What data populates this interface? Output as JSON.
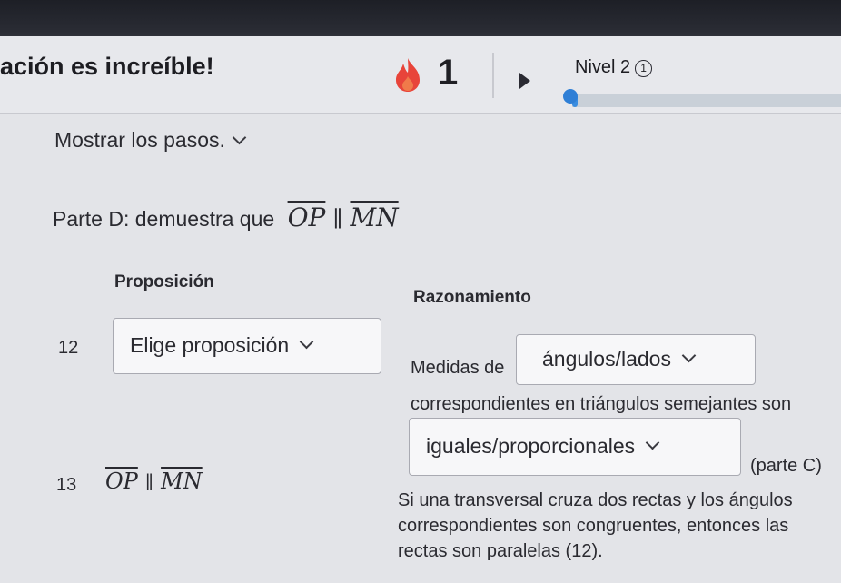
{
  "header": {
    "title": "ación es increíble!",
    "streak": "1",
    "level_label": "Nivel 2",
    "level_info": "1",
    "progress": 0.02
  },
  "lesson": {
    "show_steps": "Mostrar los pasos.",
    "part_label": "Parte D: demuestra que",
    "seg1": "OP",
    "seg2": "MN",
    "parallel": "∥"
  },
  "table": {
    "col_statement": "Proposición",
    "col_reason": "Razonamiento",
    "rows": [
      {
        "num": "12",
        "statement_dropdown": "Elige proposición",
        "reason_pre": "Medidas de",
        "reason_dropdown1": "ángulos/lados",
        "reason_mid": "correspondientes en triángulos semejantes son",
        "reason_dropdown2": "iguales/proporcionales",
        "reason_post": "(parte C)"
      },
      {
        "num": "13",
        "statement_seg1": "OP",
        "statement_seg2": "MN",
        "reason_line1": "Si una transversal cruza dos rectas y los ángulos",
        "reason_line2": "correspondientes son congruentes, entonces las",
        "reason_line3": "rectas son paralelas (12)."
      }
    ]
  },
  "colors": {
    "accent": "#3a8de0",
    "flame": "#e8443a"
  }
}
